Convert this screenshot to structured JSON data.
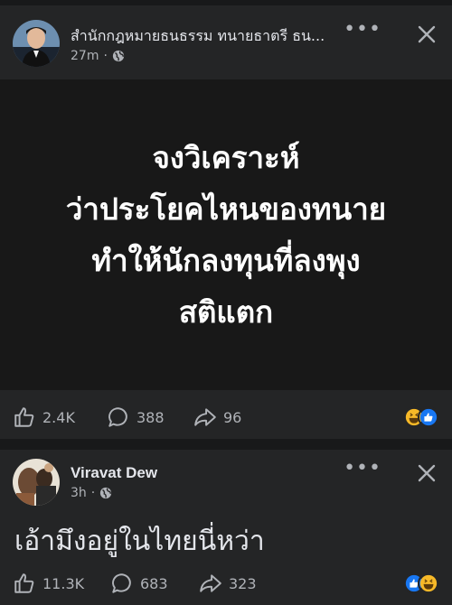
{
  "post1": {
    "author": "สำนักกฎหมายธนธรรม ทนายธาตรี ธน...",
    "time": "27m",
    "more_label": "•••",
    "media_text": "จงวิเคราะห์\nว่าประโยคไหนของทนาย\nทำให้นักลงทุนที่ลงพุง\nสติแตก",
    "likes": "2.4K",
    "comments": "388",
    "shares": "96",
    "reactions": [
      "haha",
      "like"
    ]
  },
  "post2": {
    "author": "Viravat Dew",
    "time": "3h",
    "more_label": "•••",
    "text": "เอ้ามึงอยู่ในไทยนี่หว่า",
    "likes": "11.3K",
    "comments": "683",
    "shares": "323",
    "reactions": [
      "like",
      "haha"
    ]
  },
  "colors": {
    "background": "#242526",
    "separator": "#18191a",
    "media_bg": "#181818",
    "primary_text": "#e4e6eb",
    "secondary_text": "#b0b3b8",
    "like_blue": "#1877f2",
    "haha_yellow": "#f7b928"
  }
}
